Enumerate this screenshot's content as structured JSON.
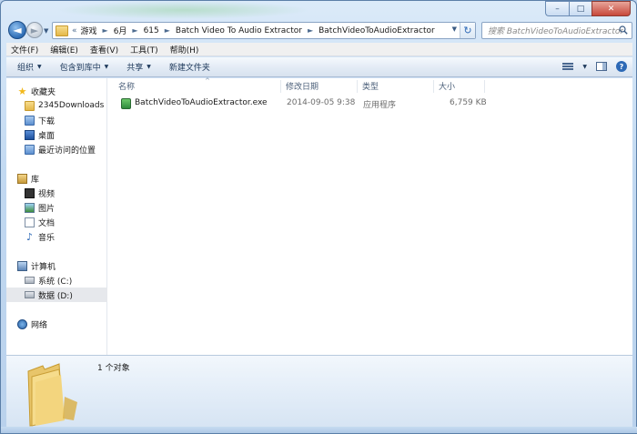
{
  "window": {
    "controls": {
      "minimize": "–",
      "maximize": "□",
      "close": "✕"
    }
  },
  "nav": {
    "back_glyph": "◄",
    "forward_glyph": "►",
    "breadcrumb_prefix": "«",
    "breadcrumbs": [
      "游戏",
      "6月",
      "615",
      "Batch Video To Audio Extractor",
      "BatchVideoToAudioExtractor"
    ],
    "refresh_glyph": "↻",
    "search_placeholder": "搜索 BatchVideoToAudioExtractor"
  },
  "menubar": {
    "items": [
      "文件(F)",
      "编辑(E)",
      "查看(V)",
      "工具(T)",
      "帮助(H)"
    ]
  },
  "commandbar": {
    "organize": "组织",
    "include_in_library": "包含到库中",
    "share": "共享",
    "new_folder": "新建文件夹",
    "help_glyph": "?"
  },
  "navpane": {
    "favorites": {
      "label": "收藏夹",
      "items": [
        "2345Downloads",
        "下载",
        "桌面",
        "最近访问的位置"
      ]
    },
    "libraries": {
      "label": "库",
      "items": [
        "视频",
        "图片",
        "文档",
        "音乐"
      ]
    },
    "computer": {
      "label": "计算机",
      "items": [
        "系统 (C:)",
        "数据 (D:)"
      ],
      "selected": "数据 (D:)"
    },
    "network": {
      "label": "网络"
    }
  },
  "filelist": {
    "columns": {
      "name": "名称",
      "modified": "修改日期",
      "type": "类型",
      "size": "大小"
    },
    "rows": [
      {
        "name": "BatchVideoToAudioExtractor.exe",
        "modified": "2014-09-05 9:38",
        "type": "应用程序",
        "size": "6,759 KB"
      }
    ]
  },
  "details": {
    "count_text": "1 个对象"
  }
}
